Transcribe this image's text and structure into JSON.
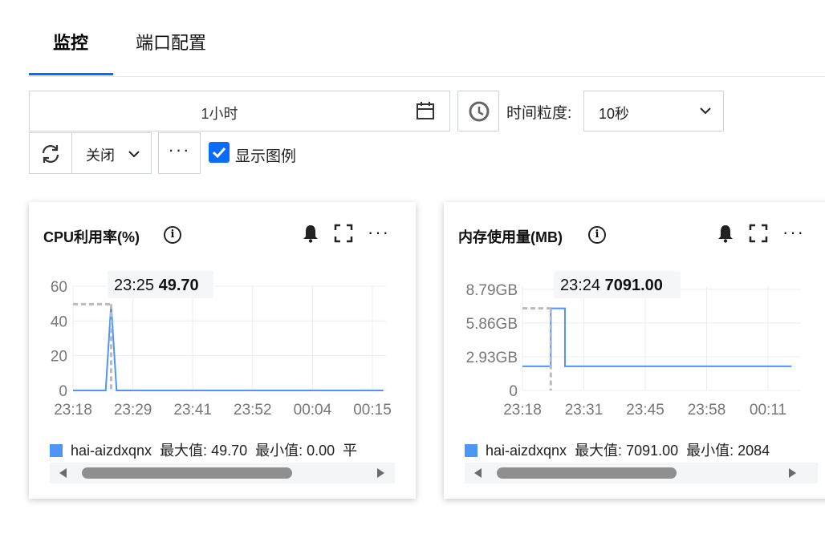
{
  "tabs": [
    {
      "label": "监控",
      "active": true
    },
    {
      "label": "端口配置",
      "active": false
    }
  ],
  "toolbar": {
    "time_range": "1小时",
    "granularity_label": "时间粒度:",
    "granularity_value": "10秒",
    "auto_refresh": "关闭",
    "more": "···",
    "show_legend_label": "显示图例",
    "show_legend_checked": true
  },
  "colors": {
    "accent": "#0a6cff",
    "series": "#4f95f5"
  },
  "cards": [
    {
      "title": "CPU利用率(%)",
      "tooltip_time": "23:25",
      "tooltip_value": "49.70",
      "legend": {
        "name": "hai-aizdxqnx",
        "max": "最大值: 49.70",
        "min": "最小值: 0.00",
        "avg": "平"
      }
    },
    {
      "title": "内存使用量(MB)",
      "tooltip_time": "23:24",
      "tooltip_value": "7091.00",
      "legend": {
        "name": "hai-aizdxqnx",
        "max": "最大值: 7091.00",
        "min": "最小值: 2084"
      }
    }
  ],
  "chart_data": [
    {
      "type": "line",
      "title": "CPU利用率(%)",
      "x_ticks": [
        "23:18",
        "23:29",
        "23:41",
        "23:52",
        "00:04",
        "00:15"
      ],
      "y_ticks": [
        "0",
        "20",
        "40",
        "60"
      ],
      "ylim": [
        0,
        60
      ],
      "series": [
        {
          "name": "hai-aizdxqnx",
          "points": [
            [
              "23:18",
              0
            ],
            [
              "23:22",
              0
            ],
            [
              "23:24",
              0
            ],
            [
              "23:25",
              49.7
            ],
            [
              "23:26",
              0
            ],
            [
              "23:40",
              0
            ],
            [
              "00:04",
              0
            ],
            [
              "00:15",
              0
            ]
          ]
        }
      ],
      "hover": {
        "x": "23:25",
        "y": 49.7
      }
    },
    {
      "type": "line",
      "title": "内存使用量(MB)",
      "x_ticks": [
        "23:18",
        "23:31",
        "23:45",
        "23:58",
        "00:11"
      ],
      "y_ticks": [
        "0",
        "2.93GB",
        "5.86GB",
        "8.79GB"
      ],
      "ylim": [
        0,
        9000
      ],
      "series": [
        {
          "name": "hai-aizdxqnx",
          "points": [
            [
              "23:18",
              2084
            ],
            [
              "23:24",
              2084
            ],
            [
              "23:24",
              7091
            ],
            [
              "23:27",
              7091
            ],
            [
              "23:27",
              2084
            ],
            [
              "00:11",
              2084
            ],
            [
              "00:15",
              2084
            ]
          ]
        }
      ],
      "hover": {
        "x": "23:24",
        "y": 7091
      }
    }
  ]
}
